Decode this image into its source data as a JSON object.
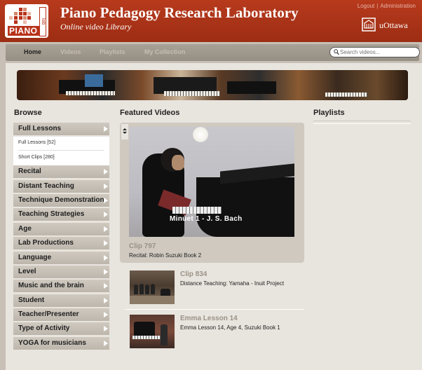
{
  "header": {
    "title": "Piano Pedagogy Research Laboratory",
    "subtitle": "Online video Library",
    "logo_text": "PIANO",
    "logo_side": "lab",
    "top_links": [
      "Logout",
      "Administration"
    ],
    "university": "uOttawa",
    "bg_color": "#a8331a"
  },
  "nav": {
    "items": [
      "Home",
      "Videos",
      "Playlists",
      "My Collection"
    ],
    "active": "Home",
    "search_placeholder": "Search videos..."
  },
  "browse": {
    "heading": "Browse",
    "items": [
      "Full Lessons",
      "Recital",
      "Distant Teaching",
      "Technique Demonstration",
      "Teaching Strategies",
      "Age",
      "Lab Productions",
      "Language",
      "Level",
      "Music and the brain",
      "Student",
      "Teacher/Presenter",
      "Type of Activity",
      "YOGA for musicians"
    ],
    "subitems": [
      "Full Lessons [52]",
      "Short Clips [280]"
    ]
  },
  "featured": {
    "heading": "Featured Videos",
    "main": {
      "title": "Clip 797",
      "desc": "Recital: Robin Suzuki Book 2",
      "overlay": "Minuet 1 - J. S. Bach"
    },
    "list": [
      {
        "title": "Clip 834",
        "desc": "Distance Teaching: Yamaha - Inuit Project"
      },
      {
        "title": "Emma Lesson 14",
        "desc": "Emma Lesson 14, Age 4, Suzuki Book 1"
      }
    ]
  },
  "playlists": {
    "heading": "Playlists"
  }
}
